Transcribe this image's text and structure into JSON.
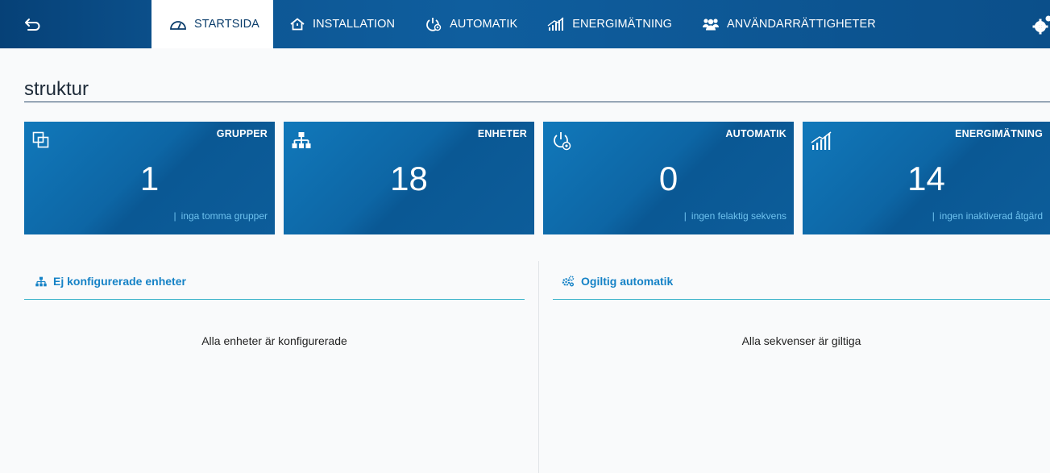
{
  "nav": {
    "tabs": [
      {
        "label": "STARTSIDA",
        "icon": "dashboard-icon",
        "active": true
      },
      {
        "label": "INSTALLATION",
        "icon": "home-icon",
        "active": false
      },
      {
        "label": "AUTOMATIK",
        "icon": "power-automation-icon",
        "active": false
      },
      {
        "label": "ENERGIMÄTNING",
        "icon": "energy-chart-icon",
        "active": false
      },
      {
        "label": "ANVÄNDARRÄTTIGHETER",
        "icon": "users-icon",
        "active": false
      }
    ]
  },
  "page": {
    "title": "struktur"
  },
  "tiles": [
    {
      "label": "GRUPPER",
      "value": "1",
      "sub": "inga tomma grupper",
      "icon": "groups-icon"
    },
    {
      "label": "ENHETER",
      "value": "18",
      "sub": "",
      "icon": "network-icon"
    },
    {
      "label": "AUTOMATIK",
      "value": "0",
      "sub": "ingen felaktig sekvens",
      "icon": "power-automation-icon"
    },
    {
      "label": "ENERGIMÄTNING",
      "value": "14",
      "sub": "ingen inaktiverad åtgärd",
      "icon": "energy-chart-icon"
    }
  ],
  "panels": {
    "left": {
      "title": "Ej konfigurerade enheter",
      "message": "Alla enheter är konfigurerade",
      "icon": "network-icon"
    },
    "right": {
      "title": "Ogiltig automatik",
      "message": "Alla sekvenser är giltiga",
      "icon": "gears-icon"
    }
  },
  "colors": {
    "nav_bg": "#0b4f8a",
    "tile_bg": "#0d66a5",
    "accent_text": "#1582c6",
    "sub_text": "#6ec2ef",
    "panel_rule": "#3ab3c9"
  }
}
